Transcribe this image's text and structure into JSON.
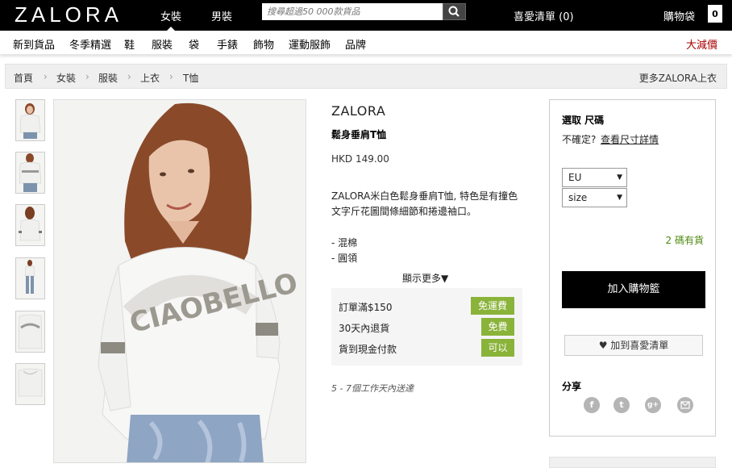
{
  "header": {
    "logo": "ZALORA",
    "nav_women": "女裝",
    "nav_men": "男裝",
    "search_placeholder": "搜尋超過50 000款貨品",
    "search_icon": "search-icon",
    "wishlist": "喜愛清單 (0)",
    "bag_label": "購物袋",
    "bag_count": "0"
  },
  "categories": [
    "新到貨品",
    "冬季精選",
    "鞋",
    "服裝",
    "袋",
    "手錶",
    "飾物",
    "運動服飾",
    "品牌"
  ],
  "sale": "大減價",
  "breadcrumb": {
    "items": [
      "首頁",
      "女裝",
      "服裝",
      "上衣",
      "T恤"
    ],
    "separator": "›",
    "more": "更多ZALORA上衣"
  },
  "product": {
    "brand": "ZALORA",
    "name": "鬆身垂肩T恤",
    "price": "HKD 149.00",
    "description": "ZALORA米白色鬆身垂肩T恤, 特色是有撞色文字斤花圖間條細節和捲邊袖口。",
    "bullets": [
      "- 混棉",
      "- 圓領"
    ],
    "show_more": "顯示更多▼",
    "shirt_text": "CIAOBELLO"
  },
  "perks": [
    {
      "label": "訂單滿$150",
      "badge": "免運費"
    },
    {
      "label": "30天內退貨",
      "badge": "免費"
    },
    {
      "label": "貨到現金付款",
      "badge": "可以"
    }
  ],
  "delivery": "5 - 7個工作天內送達",
  "size_panel": {
    "title": "選取 尺碼",
    "unsure": "不確定?",
    "size_guide": "查看尺寸詳情",
    "region_value": "EU",
    "size_placeholder": "size",
    "stock": "2 碼有貨",
    "add_to_cart": "加入購物籃",
    "add_to_wishlist": "♥ 加到喜愛清單",
    "share": "分享",
    "social_icons": [
      "facebook-icon",
      "twitter-icon",
      "google-plus-icon",
      "email-icon"
    ]
  },
  "colors": {
    "topbar": "#000000",
    "perk_badge": "#8ab33a",
    "stock_text": "#4c8a12",
    "sale_text": "#aa0000"
  }
}
